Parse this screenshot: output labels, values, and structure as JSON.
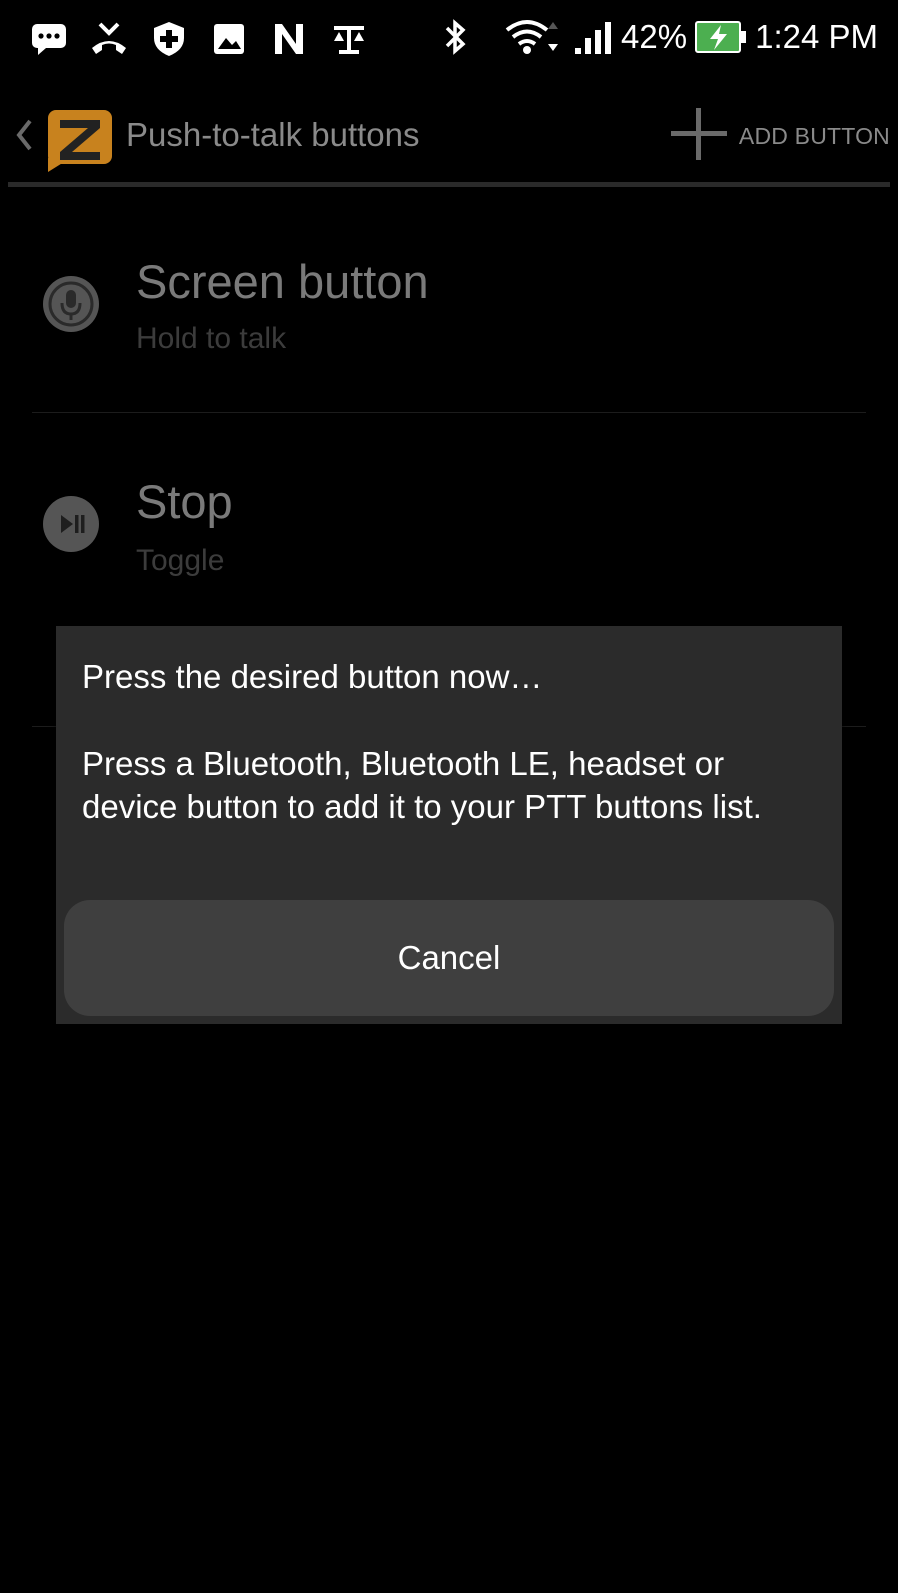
{
  "status_bar": {
    "battery_percent": "42%",
    "time": "1:24 PM",
    "left_icons": [
      "message-icon",
      "missed-call-icon",
      "shield-icon",
      "gallery-icon",
      "n-icon",
      "scale-icon"
    ],
    "right_icons": [
      "bluetooth-icon",
      "wifi-icon",
      "signal-icon",
      "battery-charging-icon"
    ]
  },
  "app_bar": {
    "title": "Push-to-talk buttons",
    "add_button_label": "ADD BUTTON",
    "logo_letter": "Z",
    "logo_color": "#c8821e"
  },
  "list": {
    "items": [
      {
        "title": "Screen button",
        "subtitle": "Hold to talk",
        "icon": "microphone-icon"
      },
      {
        "title": "Stop",
        "subtitle": "Toggle",
        "icon": "play-pause-icon"
      }
    ]
  },
  "dialog": {
    "title": "Press the desired button now…",
    "body": "Press a Bluetooth, Bluetooth LE, headset or device button to add it to your PTT buttons list.",
    "cancel_label": "Cancel"
  },
  "colors": {
    "background": "#000000",
    "dialog_bg": "#2b2b2b",
    "button_bg": "#3f3f3f",
    "battery_green": "#4caf50"
  }
}
